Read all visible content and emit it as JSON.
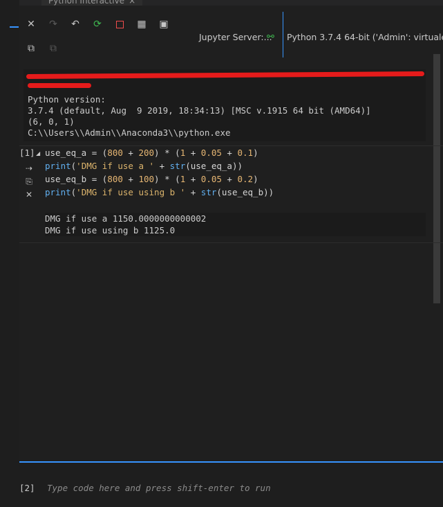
{
  "tab": {
    "title": "Python Interactive",
    "close": "×"
  },
  "toolbar": {
    "server_label": "Jupyter Server:...",
    "kernel_label": "Python 3.7.4 64-bit ('Admin': virtuale..."
  },
  "startup_output": {
    "lines": [
      "Python version:",
      "3.7.4 (default, Aug  9 2019, 18:34:13) [MSC v.1915 64 bit (AMD64)]",
      "(6, 0, 1)",
      "C:\\\\Users\\\\Admin\\\\Anaconda3\\\\python.exe"
    ]
  },
  "cell1": {
    "number": "[1]",
    "output": [
      "DMG if use a 1150.0000000000002",
      "DMG if use using b 1125.0"
    ]
  },
  "input_cell": {
    "number": "[2]",
    "placeholder": "Type code here and press shift-enter to run"
  }
}
